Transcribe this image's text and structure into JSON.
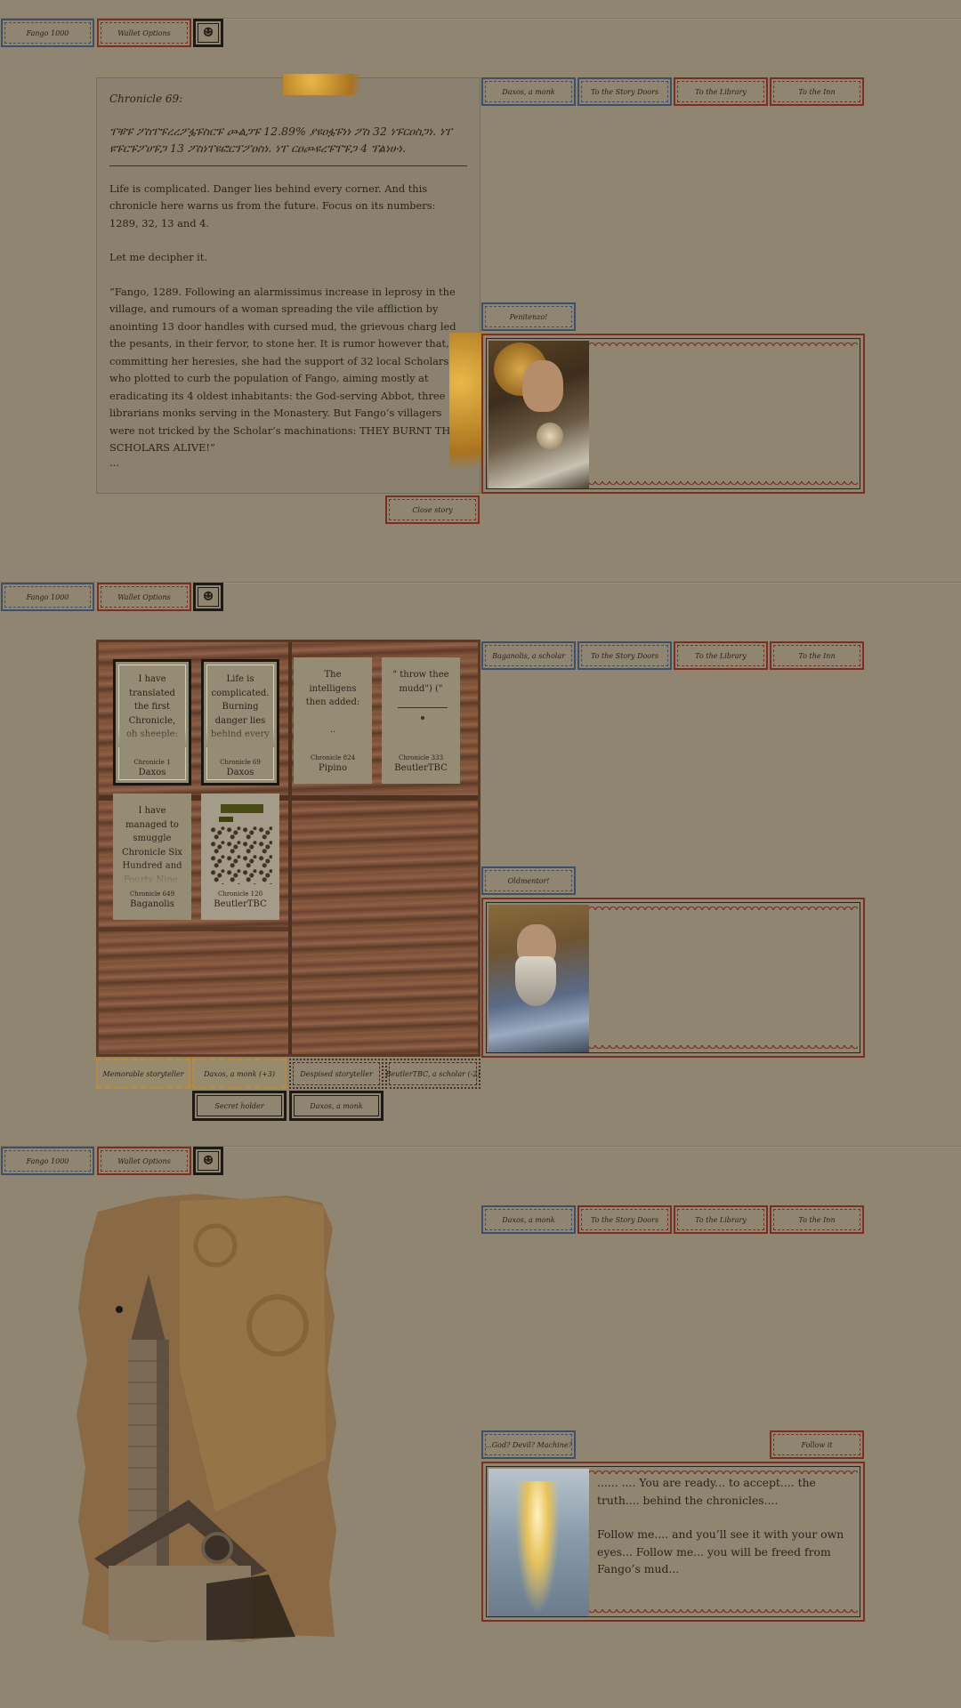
{
  "top_bar": {
    "account_label": "Fango 1000",
    "wallet_label": "Wallet Options",
    "mini_icon": "mask-icon"
  },
  "nav": {
    "panel1_character": "Daxos, a monk",
    "panel2_character": "Baganolis, a scholar",
    "panel3_character": "Daxos, a monk",
    "story_doors": "To the Story Doors",
    "library": "To the Library",
    "inn": "To the Inn"
  },
  "panel1": {
    "chronicle_title": "Chronicle 69:",
    "glyph_text": "ፐቹፑ ፖስፐፑረረፖፏፑስርፑ ጮልጋፑ 12.89% ያዩዐፏፑነነ ፖስ 32 ነፑርዐስጋነ. ነፐ ዩፑርፑፖሀፑጋ 13 ፖስነፐዩፎርፕፖዐስነ. ነፐ ርዐጮዩረፑፐፑጋ 4 ፕልነሁነ.",
    "para1": "Life is complicated. Danger lies behind every corner. And this chronicle here warns us from the future. Focus on its numbers: 1289, 32, 13 and 4.",
    "para2": "Let me decipher it.",
    "quote": "“Fango, 1289. Following an alarmissimus increase in leprosy in the village, and rumours of a woman spreading the vile affliction by anointing 13 door handles with cursed mud, the grievous charg led the pesants, in their fervor, to stone her. It is rumor however that, in committing her heresies, she had the support of 32 local Scholars, who plotted to curb the population of Fango, aiming mostly at eradicating its 4 oldest inhabitants: the God-serving Abbot, three librarians monks serving in the Monastery. But Fango’s villagers were not tricked by the Scholar’s machinations: THEY BURNT THE SCHOLARS ALIVE!”",
    "ellipsis": "...",
    "close_label": "Close story",
    "speaker_tab": "Penitenzo!"
  },
  "panel2": {
    "cards": [
      {
        "text": "I have translated the first Chronicle, oh sheeple:",
        "num": "Chronicle 1",
        "author": "Daxos",
        "framed": true
      },
      {
        "text": "Life is complicated. Burning danger lies behind every",
        "num": "Chronicle 69",
        "author": "Daxos",
        "framed": true
      },
      {
        "text": "The intelligens then added:\n\n..",
        "num": "Chronicle 824",
        "author": "Pipino",
        "framed": false
      },
      {
        "text": "\" throw thee mudd\") (\"",
        "num": "Chronicle 333",
        "author": "BeutlerTBC",
        "framed": false
      },
      {
        "text": "I have managed to smuggle Chronicle Six Hundred and Fourty Nine, oh",
        "num": "Chronicle 649",
        "author": "Baganolis",
        "framed": false
      },
      {
        "text": "",
        "num": "Chronicle 120",
        "author": "BeutlerTBC",
        "framed": false
      }
    ],
    "badges": {
      "memorable": "Memorable storyteller",
      "memorable_name": "Daxos, a monk (+3)",
      "despised": "Despised storyteller",
      "despised_name": "BeutlerTBC, a scholar (-2)",
      "secret": "Secret holder",
      "secret_name": "Daxos, a monk"
    },
    "speaker_tab": "Oldmentor!"
  },
  "panel3": {
    "speaker_tab": "...God? Devil? Machine?",
    "follow_label": "Follow it",
    "dialog_p1": "...... .... You are ready... to accept.... the truth.... behind the chronicles....",
    "dialog_p2": "Follow me.... and you’ll see it with your own eyes... Follow me...  you will be freed from Fango’s mud..."
  },
  "colors": {
    "background": "#8f8570",
    "blue_frame": "#3e4f6b",
    "red_frame": "#7a2f22",
    "gold": "#c08a2e",
    "wood": "#7b5038"
  }
}
